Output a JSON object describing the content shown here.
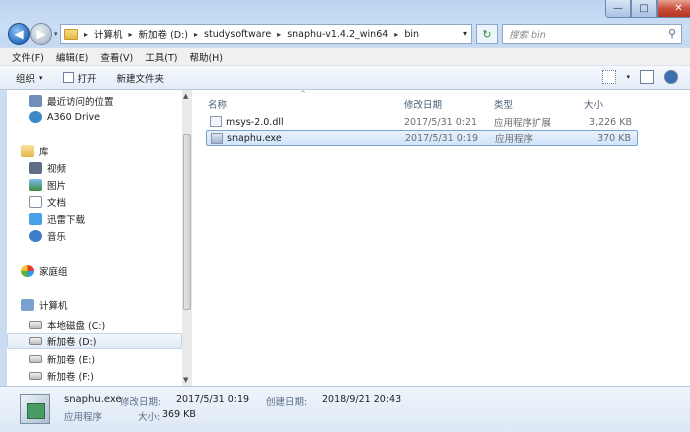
{
  "window": {
    "controls": {
      "minimize": "—",
      "maximize": "□",
      "close": "✕"
    }
  },
  "nav": {
    "back": "◀",
    "forward": "▶",
    "recent": "▾"
  },
  "address": {
    "crumbs": [
      "计算机",
      "新加卷 (D:)",
      "studysoftware",
      "snaphu-v1.4.2_win64",
      "bin"
    ],
    "separator": "▸",
    "dropdown": "▾"
  },
  "refresh_glyph": "↻",
  "search": {
    "placeholder": "搜索 bin",
    "icon": "⚲"
  },
  "menu": [
    "文件(F)",
    "编辑(E)",
    "查看(V)",
    "工具(T)",
    "帮助(H)"
  ],
  "toolbar": {
    "organize": "组织",
    "open": "打开",
    "new_folder": "新建文件夹",
    "dropdown": "▾"
  },
  "navpane": {
    "expand_glyph": "▸",
    "collapse_glyph": "◢",
    "favorites": [
      {
        "label": "最近访问的位置",
        "icon": "recent-places-icon"
      },
      {
        "label": "A360 Drive",
        "icon": "a360-drive-icon"
      }
    ],
    "libraries": {
      "label": "库",
      "items": [
        {
          "label": "视频",
          "icon": "video-library-icon"
        },
        {
          "label": "图片",
          "icon": "picture-library-icon"
        },
        {
          "label": "文档",
          "icon": "document-library-icon"
        },
        {
          "label": "迅雷下载",
          "icon": "thunder-download-icon"
        },
        {
          "label": "音乐",
          "icon": "music-library-icon"
        }
      ]
    },
    "homegroup": "家庭组",
    "computer": {
      "label": "计算机",
      "drives": [
        {
          "label": "本地磁盘 (C:)"
        },
        {
          "label": "新加卷 (D:)",
          "selected": true
        },
        {
          "label": "新加卷 (E:)"
        },
        {
          "label": "新加卷 (F:)"
        }
      ]
    }
  },
  "columns": {
    "name": "名称",
    "modified": "修改日期",
    "type": "类型",
    "size": "大小",
    "sort_glyph": "^"
  },
  "files": [
    {
      "name": "msys-2.0.dll",
      "modified": "2017/5/31 0:21",
      "type": "应用程序扩展",
      "size": "3,226 KB",
      "selected": false
    },
    {
      "name": "snaphu.exe",
      "modified": "2017/5/31 0:19",
      "type": "应用程序",
      "size": "370 KB",
      "selected": true
    }
  ],
  "status": {
    "name": "snaphu.exe",
    "modified_label": "修改日期:",
    "modified": "2017/5/31 0:19",
    "created_label": "创建日期:",
    "created": "2018/9/21 20:43",
    "type": "应用程序",
    "size_label": "大小:",
    "size": "369 KB"
  }
}
